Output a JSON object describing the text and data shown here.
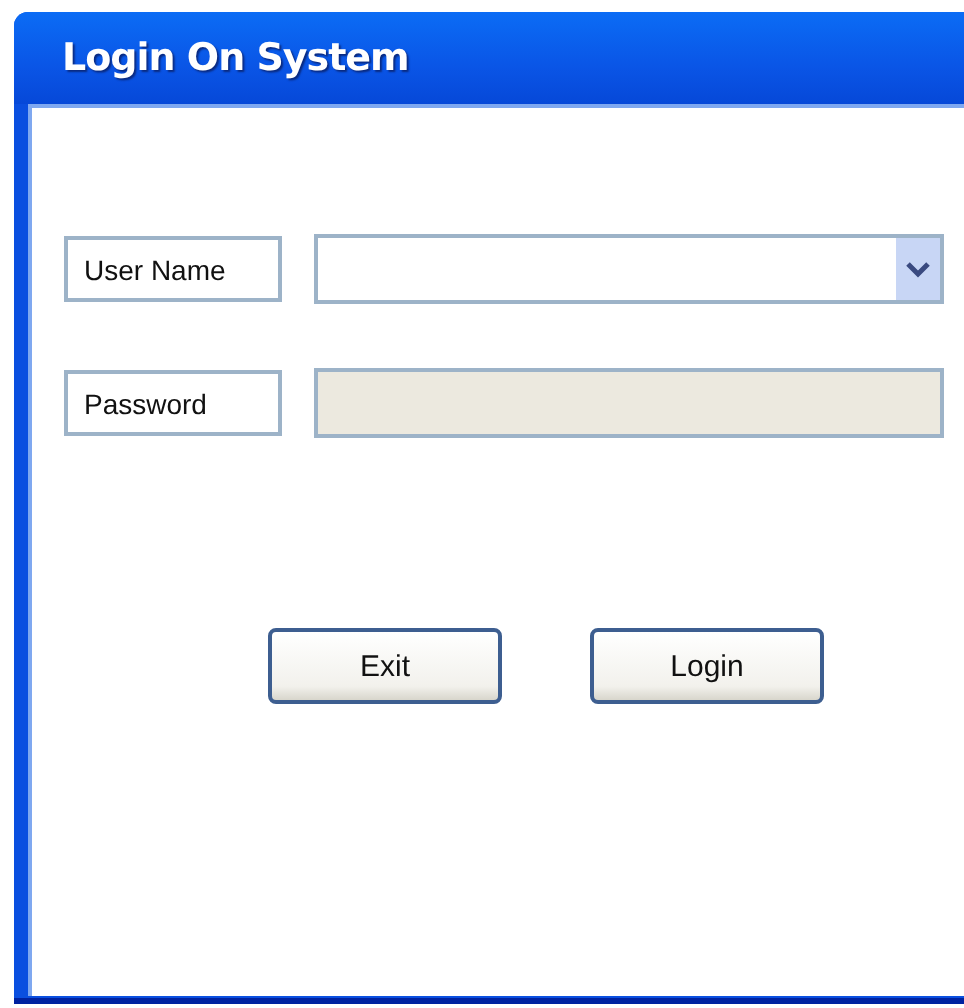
{
  "window": {
    "title": "Login On System"
  },
  "fields": [
    {
      "label": "User Name",
      "kind": "dropdown",
      "disabled": false
    },
    {
      "label": "Password",
      "kind": "text",
      "disabled": true
    }
  ],
  "buttons": [
    "Exit",
    "Login"
  ]
}
